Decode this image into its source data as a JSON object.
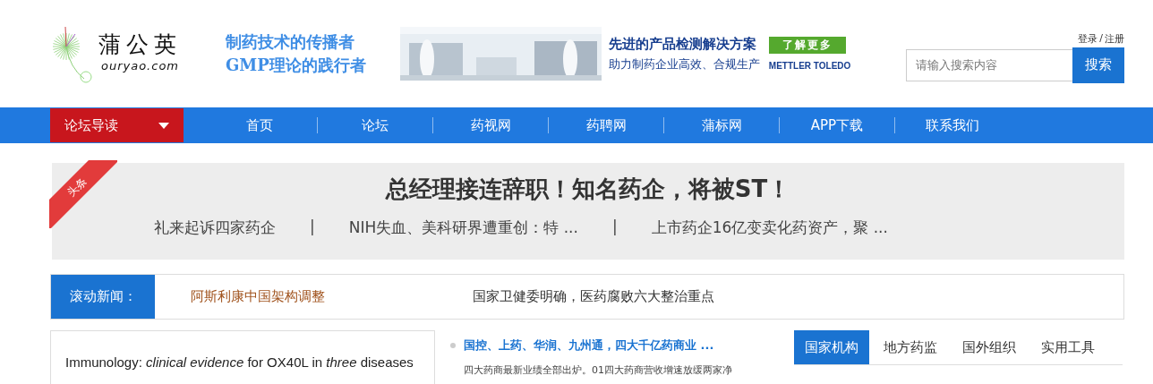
{
  "logo": {
    "name": "蒲公英",
    "domain": "ouryao.com"
  },
  "slogans": [
    "制药技术的传播者",
    "GMP理论的践行者"
  ],
  "ad": {
    "kind": "picture",
    "headline": "先进的产品检测解决方案",
    "subline": "助力制药企业高效、合规生产",
    "button": "了解更多",
    "brand": "METTLER TOLEDO"
  },
  "account": {
    "login": "登录",
    "separator": "/",
    "register": "注册"
  },
  "search": {
    "placeholder": "请输入搜索内容",
    "button": "搜索"
  },
  "nav": {
    "menu": "论坛导读",
    "items": [
      "首页",
      "论坛",
      "药视网",
      "药聘网",
      "蒲标网",
      "APP下载",
      "联系我们"
    ]
  },
  "headline": {
    "ribbon": "头条",
    "title": "总经理接连辞职！知名药企，将被ST！",
    "links": [
      "礼来起诉四家药企",
      "NIH失血、美科研界遭重创：特 ...",
      "上市药企16亿变卖化药资产，聚 ..."
    ],
    "separator": "|"
  },
  "ticker": {
    "label": "滚动新闻：",
    "items": [
      {
        "text": "阿斯利康中国架构调整",
        "color": "#a0521c"
      },
      {
        "text": "国家卫健委明确，医药腐败六大整治重点",
        "color": "#333333"
      }
    ]
  },
  "promo": {
    "text": "Immunology: *clinical evidence* for OX40L in *three* diseases"
  },
  "news": {
    "title": "国控、上药、华润、九州通，四大千亿药商业 ...",
    "excerpt": "四大药商最新业绩全部出炉。01四大药商营收增速放缓两家净"
  },
  "tabs": [
    {
      "label": "国家机构",
      "selected": true
    },
    {
      "label": "地方药监",
      "selected": false
    },
    {
      "label": "国外组织",
      "selected": false
    },
    {
      "label": "实用工具",
      "selected": false
    }
  ]
}
